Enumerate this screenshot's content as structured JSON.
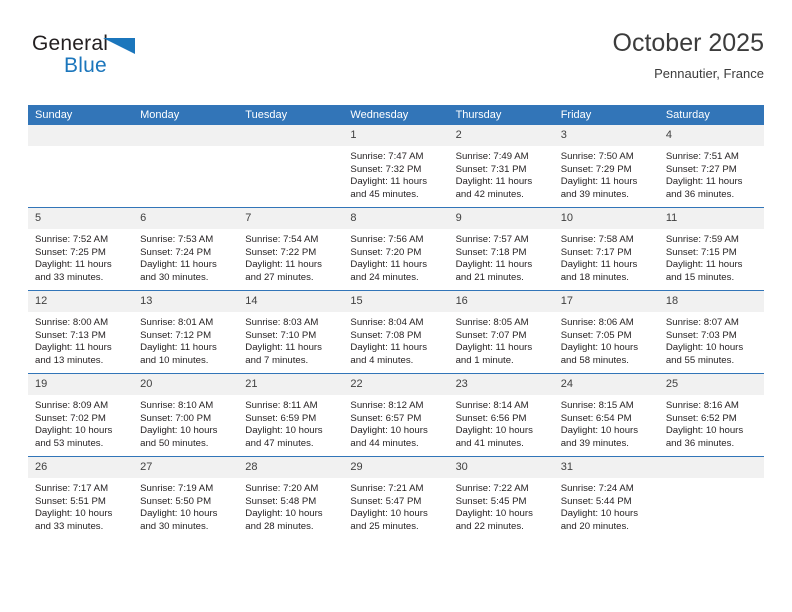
{
  "brand": {
    "name_top": "General",
    "name_bottom": "Blue",
    "accent_color": "#1b76bc",
    "flag_icon": "general-blue-flag-icon"
  },
  "header": {
    "title": "October 2025",
    "subtitle": "Pennautier, France"
  },
  "theme": {
    "header_blue": "#3275b8",
    "daynum_band": "#f1f1f1",
    "text": "#231f20"
  },
  "calendar": {
    "weekday_headers": [
      "Sunday",
      "Monday",
      "Tuesday",
      "Wednesday",
      "Thursday",
      "Friday",
      "Saturday"
    ],
    "labels": {
      "sunrise": "Sunrise:",
      "sunset": "Sunset:",
      "daylight": "Daylight:"
    },
    "weeks": [
      [
        {
          "day": "",
          "empty": true,
          "sunrise": "",
          "sunset": "",
          "daylight_line1": "",
          "daylight_line2": ""
        },
        {
          "day": "",
          "empty": true,
          "sunrise": "",
          "sunset": "",
          "daylight_line1": "",
          "daylight_line2": ""
        },
        {
          "day": "",
          "empty": true,
          "sunrise": "",
          "sunset": "",
          "daylight_line1": "",
          "daylight_line2": ""
        },
        {
          "day": "1",
          "sunrise": "Sunrise: 7:47 AM",
          "sunset": "Sunset: 7:32 PM",
          "daylight_line1": "Daylight: 11 hours",
          "daylight_line2": "and 45 minutes."
        },
        {
          "day": "2",
          "sunrise": "Sunrise: 7:49 AM",
          "sunset": "Sunset: 7:31 PM",
          "daylight_line1": "Daylight: 11 hours",
          "daylight_line2": "and 42 minutes."
        },
        {
          "day": "3",
          "sunrise": "Sunrise: 7:50 AM",
          "sunset": "Sunset: 7:29 PM",
          "daylight_line1": "Daylight: 11 hours",
          "daylight_line2": "and 39 minutes."
        },
        {
          "day": "4",
          "sunrise": "Sunrise: 7:51 AM",
          "sunset": "Sunset: 7:27 PM",
          "daylight_line1": "Daylight: 11 hours",
          "daylight_line2": "and 36 minutes."
        }
      ],
      [
        {
          "day": "5",
          "sunrise": "Sunrise: 7:52 AM",
          "sunset": "Sunset: 7:25 PM",
          "daylight_line1": "Daylight: 11 hours",
          "daylight_line2": "and 33 minutes."
        },
        {
          "day": "6",
          "sunrise": "Sunrise: 7:53 AM",
          "sunset": "Sunset: 7:24 PM",
          "daylight_line1": "Daylight: 11 hours",
          "daylight_line2": "and 30 minutes."
        },
        {
          "day": "7",
          "sunrise": "Sunrise: 7:54 AM",
          "sunset": "Sunset: 7:22 PM",
          "daylight_line1": "Daylight: 11 hours",
          "daylight_line2": "and 27 minutes."
        },
        {
          "day": "8",
          "sunrise": "Sunrise: 7:56 AM",
          "sunset": "Sunset: 7:20 PM",
          "daylight_line1": "Daylight: 11 hours",
          "daylight_line2": "and 24 minutes."
        },
        {
          "day": "9",
          "sunrise": "Sunrise: 7:57 AM",
          "sunset": "Sunset: 7:18 PM",
          "daylight_line1": "Daylight: 11 hours",
          "daylight_line2": "and 21 minutes."
        },
        {
          "day": "10",
          "sunrise": "Sunrise: 7:58 AM",
          "sunset": "Sunset: 7:17 PM",
          "daylight_line1": "Daylight: 11 hours",
          "daylight_line2": "and 18 minutes."
        },
        {
          "day": "11",
          "sunrise": "Sunrise: 7:59 AM",
          "sunset": "Sunset: 7:15 PM",
          "daylight_line1": "Daylight: 11 hours",
          "daylight_line2": "and 15 minutes."
        }
      ],
      [
        {
          "day": "12",
          "sunrise": "Sunrise: 8:00 AM",
          "sunset": "Sunset: 7:13 PM",
          "daylight_line1": "Daylight: 11 hours",
          "daylight_line2": "and 13 minutes."
        },
        {
          "day": "13",
          "sunrise": "Sunrise: 8:01 AM",
          "sunset": "Sunset: 7:12 PM",
          "daylight_line1": "Daylight: 11 hours",
          "daylight_line2": "and 10 minutes."
        },
        {
          "day": "14",
          "sunrise": "Sunrise: 8:03 AM",
          "sunset": "Sunset: 7:10 PM",
          "daylight_line1": "Daylight: 11 hours",
          "daylight_line2": "and 7 minutes."
        },
        {
          "day": "15",
          "sunrise": "Sunrise: 8:04 AM",
          "sunset": "Sunset: 7:08 PM",
          "daylight_line1": "Daylight: 11 hours",
          "daylight_line2": "and 4 minutes."
        },
        {
          "day": "16",
          "sunrise": "Sunrise: 8:05 AM",
          "sunset": "Sunset: 7:07 PM",
          "daylight_line1": "Daylight: 11 hours",
          "daylight_line2": "and 1 minute."
        },
        {
          "day": "17",
          "sunrise": "Sunrise: 8:06 AM",
          "sunset": "Sunset: 7:05 PM",
          "daylight_line1": "Daylight: 10 hours",
          "daylight_line2": "and 58 minutes."
        },
        {
          "day": "18",
          "sunrise": "Sunrise: 8:07 AM",
          "sunset": "Sunset: 7:03 PM",
          "daylight_line1": "Daylight: 10 hours",
          "daylight_line2": "and 55 minutes."
        }
      ],
      [
        {
          "day": "19",
          "sunrise": "Sunrise: 8:09 AM",
          "sunset": "Sunset: 7:02 PM",
          "daylight_line1": "Daylight: 10 hours",
          "daylight_line2": "and 53 minutes."
        },
        {
          "day": "20",
          "sunrise": "Sunrise: 8:10 AM",
          "sunset": "Sunset: 7:00 PM",
          "daylight_line1": "Daylight: 10 hours",
          "daylight_line2": "and 50 minutes."
        },
        {
          "day": "21",
          "sunrise": "Sunrise: 8:11 AM",
          "sunset": "Sunset: 6:59 PM",
          "daylight_line1": "Daylight: 10 hours",
          "daylight_line2": "and 47 minutes."
        },
        {
          "day": "22",
          "sunrise": "Sunrise: 8:12 AM",
          "sunset": "Sunset: 6:57 PM",
          "daylight_line1": "Daylight: 10 hours",
          "daylight_line2": "and 44 minutes."
        },
        {
          "day": "23",
          "sunrise": "Sunrise: 8:14 AM",
          "sunset": "Sunset: 6:56 PM",
          "daylight_line1": "Daylight: 10 hours",
          "daylight_line2": "and 41 minutes."
        },
        {
          "day": "24",
          "sunrise": "Sunrise: 8:15 AM",
          "sunset": "Sunset: 6:54 PM",
          "daylight_line1": "Daylight: 10 hours",
          "daylight_line2": "and 39 minutes."
        },
        {
          "day": "25",
          "sunrise": "Sunrise: 8:16 AM",
          "sunset": "Sunset: 6:52 PM",
          "daylight_line1": "Daylight: 10 hours",
          "daylight_line2": "and 36 minutes."
        }
      ],
      [
        {
          "day": "26",
          "sunrise": "Sunrise: 7:17 AM",
          "sunset": "Sunset: 5:51 PM",
          "daylight_line1": "Daylight: 10 hours",
          "daylight_line2": "and 33 minutes."
        },
        {
          "day": "27",
          "sunrise": "Sunrise: 7:19 AM",
          "sunset": "Sunset: 5:50 PM",
          "daylight_line1": "Daylight: 10 hours",
          "daylight_line2": "and 30 minutes."
        },
        {
          "day": "28",
          "sunrise": "Sunrise: 7:20 AM",
          "sunset": "Sunset: 5:48 PM",
          "daylight_line1": "Daylight: 10 hours",
          "daylight_line2": "and 28 minutes."
        },
        {
          "day": "29",
          "sunrise": "Sunrise: 7:21 AM",
          "sunset": "Sunset: 5:47 PM",
          "daylight_line1": "Daylight: 10 hours",
          "daylight_line2": "and 25 minutes."
        },
        {
          "day": "30",
          "sunrise": "Sunrise: 7:22 AM",
          "sunset": "Sunset: 5:45 PM",
          "daylight_line1": "Daylight: 10 hours",
          "daylight_line2": "and 22 minutes."
        },
        {
          "day": "31",
          "sunrise": "Sunrise: 7:24 AM",
          "sunset": "Sunset: 5:44 PM",
          "daylight_line1": "Daylight: 10 hours",
          "daylight_line2": "and 20 minutes."
        },
        {
          "day": "",
          "empty": true,
          "sunrise": "",
          "sunset": "",
          "daylight_line1": "",
          "daylight_line2": ""
        }
      ]
    ]
  }
}
